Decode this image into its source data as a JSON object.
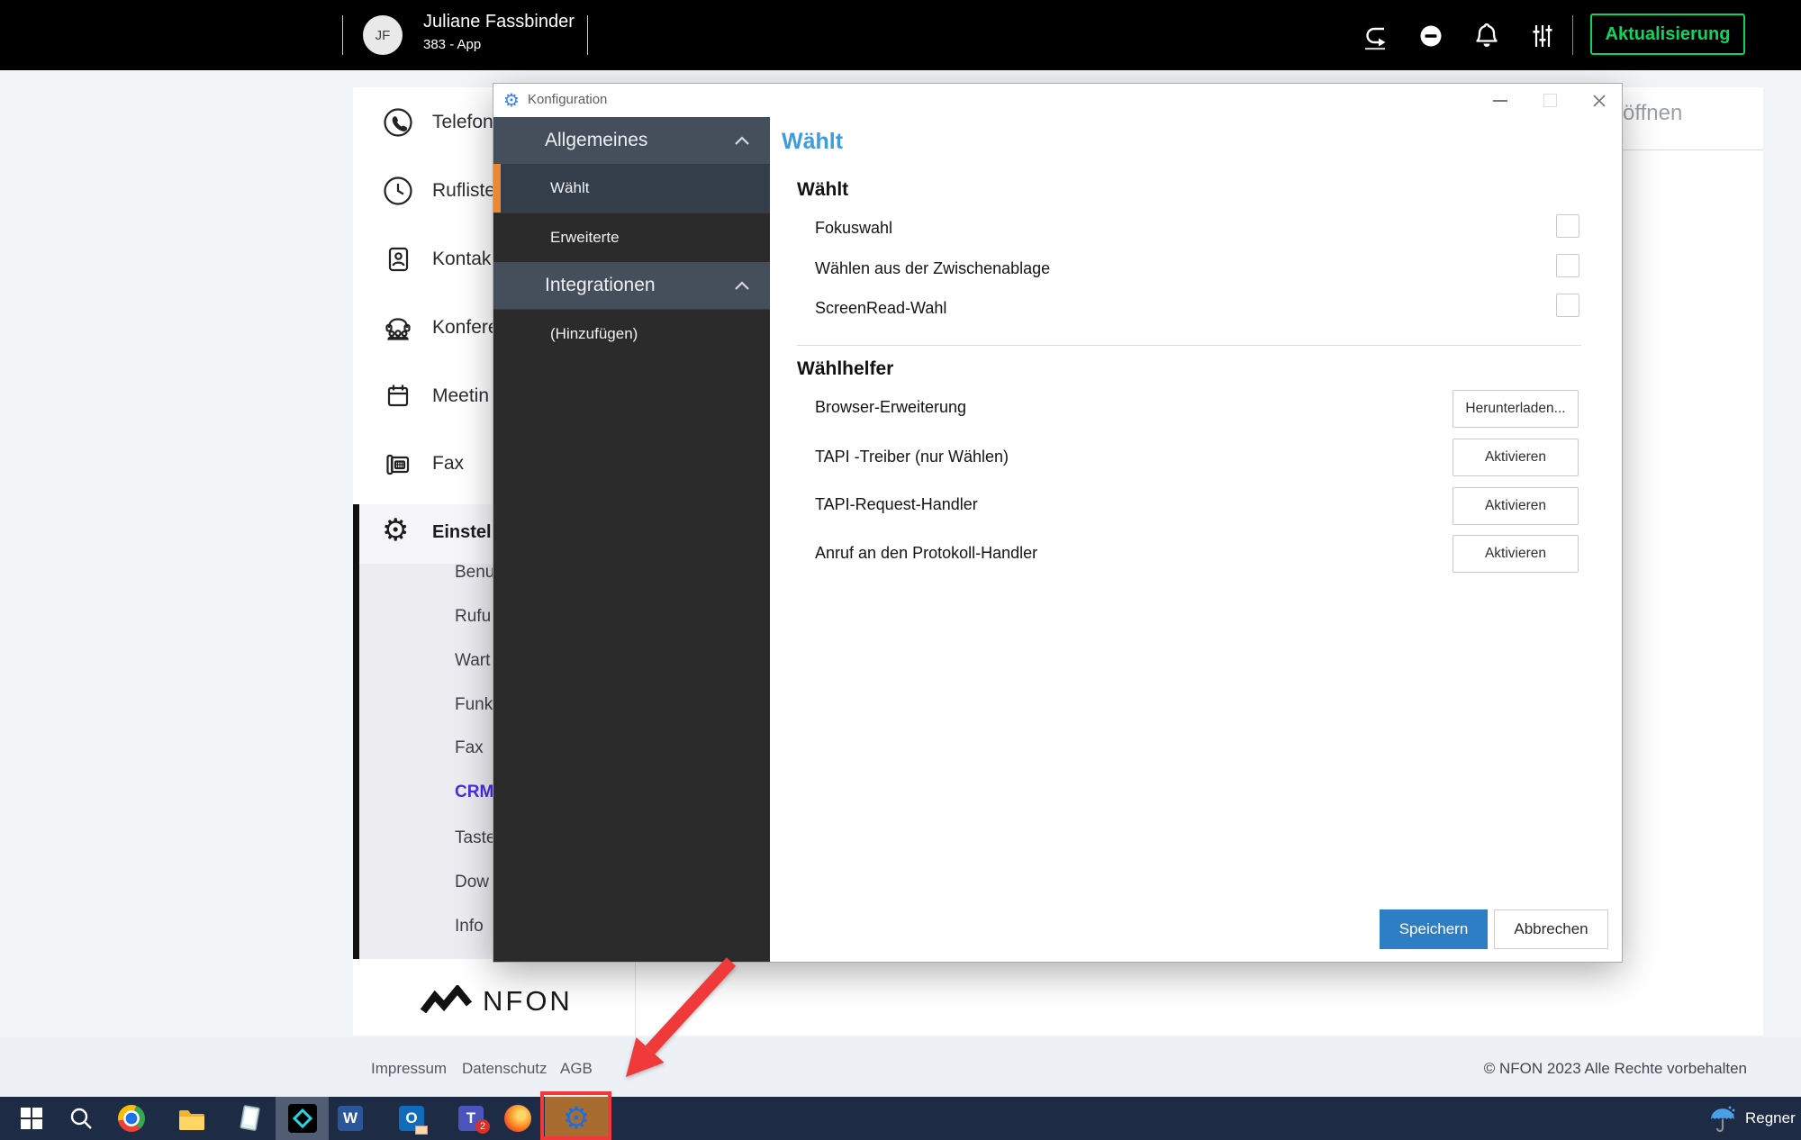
{
  "topbar": {
    "avatar": "JF",
    "name": "Juliane Fassbinder",
    "subtitle": "383 - App",
    "update_button": "Aktualisierung"
  },
  "sidebar": {
    "items": [
      {
        "icon": "phone-icon",
        "label": "Telefon"
      },
      {
        "icon": "clock-icon",
        "label": "Rufliste"
      },
      {
        "icon": "contact-card-icon",
        "label": "Kontak"
      },
      {
        "icon": "conference-icon",
        "label": "Konfere"
      },
      {
        "icon": "calendar-icon",
        "label": "Meetin"
      },
      {
        "icon": "fax-icon",
        "label": "Fax"
      }
    ],
    "settings_label": "Einstell",
    "settings_items": [
      {
        "label": "Benu"
      },
      {
        "label": "Rufu"
      },
      {
        "label": "Wart"
      },
      {
        "label": "Funk"
      },
      {
        "label": "Fax"
      },
      {
        "label": "CRM"
      },
      {
        "label": "Taste"
      },
      {
        "label": "Dow"
      },
      {
        "label": "Info"
      }
    ],
    "active_settings_item": "CRM",
    "logo": "NFON"
  },
  "main": {
    "search_hint": "öffnen"
  },
  "dialog": {
    "title": "Konfiguration",
    "nav": {
      "group1": "Allgemeines",
      "item1": "Wählt",
      "item2": "Erweiterte",
      "group2": "Integrationen",
      "item3": "(Hinzufügen)"
    },
    "selected_nav_item": "Wählt",
    "page_title": "Wählt",
    "section1": {
      "title": "Wählt",
      "rows": [
        {
          "label": "Fokuswahl",
          "checked": false
        },
        {
          "label": "Wählen aus der Zwischenablage",
          "checked": false
        },
        {
          "label": "ScreenRead-Wahl",
          "checked": false
        }
      ]
    },
    "section2": {
      "title": "Wählhelfer",
      "rows": [
        {
          "label": "Browser-Erweiterung",
          "button": "Herunterladen..."
        },
        {
          "label": "TAPI -Treiber (nur Wählen)",
          "button": "Aktivieren"
        },
        {
          "label": "TAPI-Request-Handler",
          "button": "Aktivieren"
        },
        {
          "label": "Anruf an den Protokoll-Handler",
          "button": "Aktivieren"
        }
      ]
    },
    "save_button": "Speichern",
    "cancel_button": "Abbrechen"
  },
  "footer": {
    "links": [
      {
        "label": "Impressum"
      },
      {
        "label": "Datenschutz"
      },
      {
        "label": "AGB"
      }
    ],
    "copyright": "© NFON 2023 Alle Rechte vorbehalten"
  },
  "taskbar": {
    "teams_badge": "2",
    "weather": "Regner",
    "word_letter": "W",
    "outlook_letter": "O",
    "teams_letter": "T"
  },
  "icons": {
    "gear": "⚙"
  },
  "colors": {
    "accent_green": "#10d35f",
    "heading_blue": "#3d9ce1",
    "save_blue": "#2d7ec4",
    "nav_orange": "#ed8733",
    "crm_purple": "#4b2ee0",
    "annotation_red": "#f0393b",
    "taskbar_navy": "#1e2b45"
  }
}
